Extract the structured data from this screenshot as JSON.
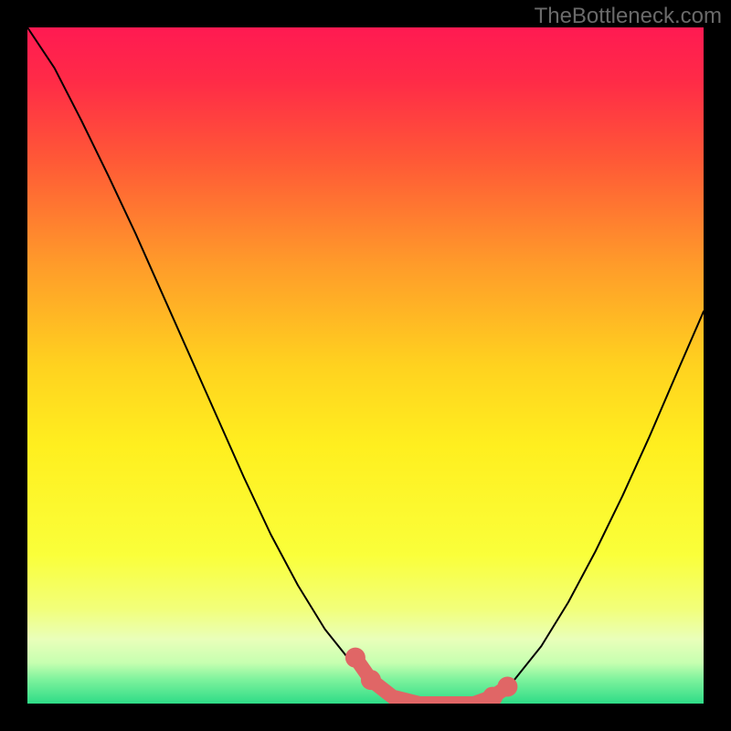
{
  "watermark": "TheBottleneck.com",
  "chart_data": {
    "type": "line",
    "title": "",
    "xlabel": "",
    "ylabel": "",
    "xlim": [
      0,
      1
    ],
    "ylim": [
      0,
      1
    ],
    "curves": [
      {
        "name": "left-curve",
        "x": [
          0.0,
          0.04,
          0.08,
          0.12,
          0.16,
          0.2,
          0.24,
          0.28,
          0.32,
          0.36,
          0.4,
          0.44,
          0.48,
          0.508,
          0.54
        ],
        "y": [
          1.0,
          0.94,
          0.862,
          0.78,
          0.695,
          0.605,
          0.515,
          0.425,
          0.335,
          0.25,
          0.175,
          0.11,
          0.06,
          0.032,
          0.01
        ]
      },
      {
        "name": "right-curve",
        "x": [
          0.688,
          0.72,
          0.76,
          0.8,
          0.84,
          0.88,
          0.92,
          0.96,
          1.0
        ],
        "y": [
          0.01,
          0.035,
          0.085,
          0.15,
          0.225,
          0.307,
          0.395,
          0.488,
          0.58
        ]
      }
    ],
    "marker_path": {
      "name": "marker-path",
      "color": "#e06666",
      "points": [
        {
          "x": 0.485,
          "y": 0.068,
          "dot": true
        },
        {
          "x": 0.508,
          "y": 0.035,
          "dot": true
        },
        {
          "x": 0.54,
          "y": 0.01,
          "dot": false
        },
        {
          "x": 0.58,
          "y": 0.0,
          "dot": false
        },
        {
          "x": 0.62,
          "y": 0.0,
          "dot": false
        },
        {
          "x": 0.66,
          "y": 0.0,
          "dot": false
        },
        {
          "x": 0.688,
          "y": 0.01,
          "dot": true
        },
        {
          "x": 0.71,
          "y": 0.025,
          "dot": true
        }
      ]
    },
    "gradient_stops": [
      {
        "offset": 0.0,
        "color": "#ff1a52"
      },
      {
        "offset": 0.08,
        "color": "#ff2b47"
      },
      {
        "offset": 0.2,
        "color": "#ff5a36"
      },
      {
        "offset": 0.35,
        "color": "#ff9b2a"
      },
      {
        "offset": 0.5,
        "color": "#ffd21f"
      },
      {
        "offset": 0.62,
        "color": "#ffef1f"
      },
      {
        "offset": 0.78,
        "color": "#faff3a"
      },
      {
        "offset": 0.86,
        "color": "#f2ff7a"
      },
      {
        "offset": 0.905,
        "color": "#e9ffba"
      },
      {
        "offset": 0.94,
        "color": "#c6ffb0"
      },
      {
        "offset": 0.965,
        "color": "#7cf29c"
      },
      {
        "offset": 1.0,
        "color": "#2edc87"
      }
    ]
  }
}
